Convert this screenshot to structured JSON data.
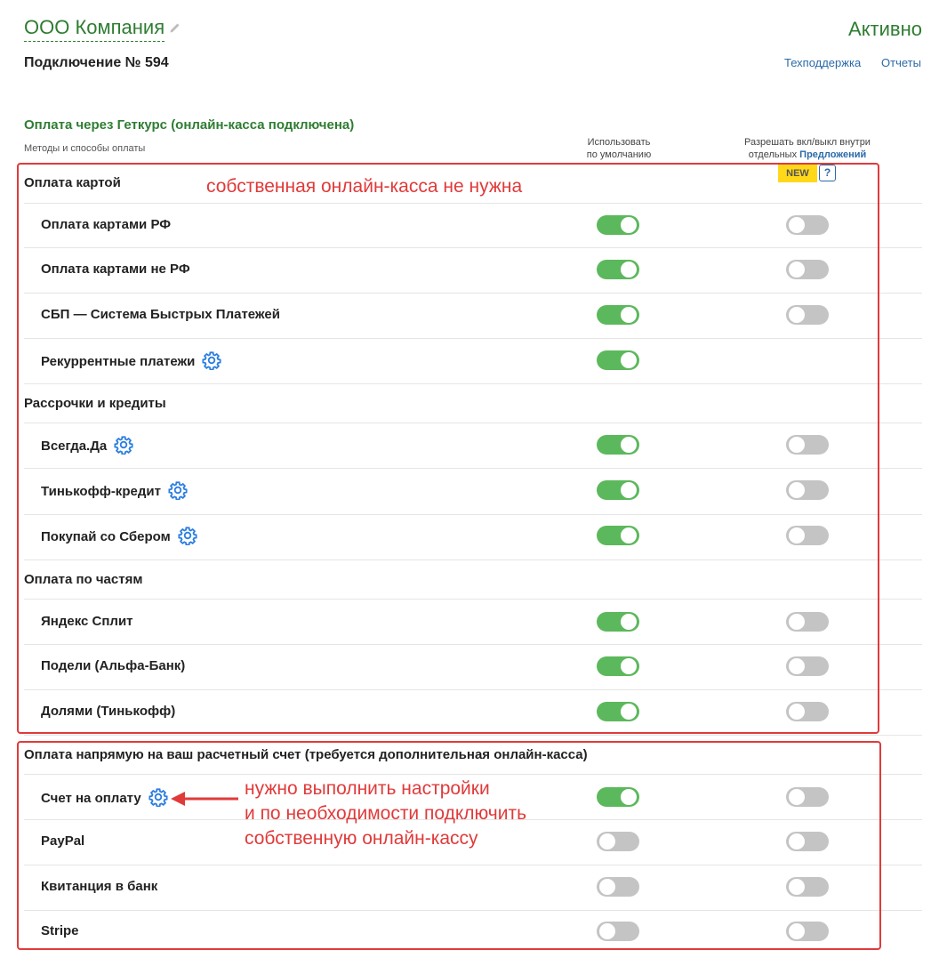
{
  "header": {
    "company_name": "ООО Компания",
    "status": "Активно",
    "connection": "Подключение № 594",
    "links": {
      "support": "Техподдержка",
      "reports": "Отчеты"
    }
  },
  "section": {
    "title": "Оплата через Геткурс (онлайн-касса подключена)",
    "methods_label": "Методы и способы оплаты",
    "col_default_line1": "Использовать",
    "col_default_line2": "по умолчанию",
    "col_allow_line1": "Разрешать вкл/выкл внутри",
    "col_allow_line2": "отдельных",
    "col_allow_link": "Предложений",
    "new_badge": "NEW",
    "help": "?"
  },
  "groups": {
    "card": "Оплата картой",
    "installments": "Рассрочки и кредиты",
    "parts": "Оплата по частям",
    "direct": "Оплата напрямую на ваш расчетный счет (требуется дополнительная онлайн-касса)"
  },
  "rows": [
    {
      "label": "Оплата картами РФ",
      "gear": false,
      "default": "on",
      "allow": "off"
    },
    {
      "label": "Оплата картами не РФ",
      "gear": false,
      "default": "on",
      "allow": "off"
    },
    {
      "label": "СБП — Система Быстрых Платежей",
      "gear": false,
      "default": "on",
      "allow": "off"
    },
    {
      "label": "Рекуррентные платежи",
      "gear": true,
      "default": "on",
      "allow": null
    },
    {
      "label": "Всегда.Да",
      "gear": true,
      "default": "on",
      "allow": "off"
    },
    {
      "label": "Тинькофф-кредит",
      "gear": true,
      "default": "on",
      "allow": "off"
    },
    {
      "label": "Покупай со Сбером",
      "gear": true,
      "default": "on",
      "allow": "off"
    },
    {
      "label": "Яндекс Сплит",
      "gear": false,
      "default": "on",
      "allow": "off"
    },
    {
      "label": "Подели (Альфа-Банк)",
      "gear": false,
      "default": "on",
      "allow": "off"
    },
    {
      "label": "Долями (Тинькофф)",
      "gear": false,
      "default": "on",
      "allow": "off"
    },
    {
      "label": "Счет на оплату",
      "gear": true,
      "default": "on",
      "allow": "off"
    },
    {
      "label": "PayPal",
      "gear": false,
      "default": "off",
      "allow": "off"
    },
    {
      "label": "Квитанция в банк",
      "gear": false,
      "default": "off",
      "allow": "off"
    },
    {
      "label": "Stripe",
      "gear": false,
      "default": "off",
      "allow": "off"
    }
  ],
  "annotations": {
    "top": "собственная онлайн-касса не нужна",
    "bottom_line1": "нужно выполнить настройки",
    "bottom_line2": "и по необходимости подключить",
    "bottom_line3": "собственную онлайн-кассу"
  },
  "colors": {
    "green": "#2e7d32",
    "toggle_on": "#5cb85c",
    "toggle_off": "#c4c4c4",
    "link": "#2b6aa8",
    "annotation": "#e03a3a",
    "badge": "#ffd81a"
  },
  "icons": [
    "pencil-icon",
    "gear-icon",
    "help-icon",
    "arrow-icon"
  ]
}
